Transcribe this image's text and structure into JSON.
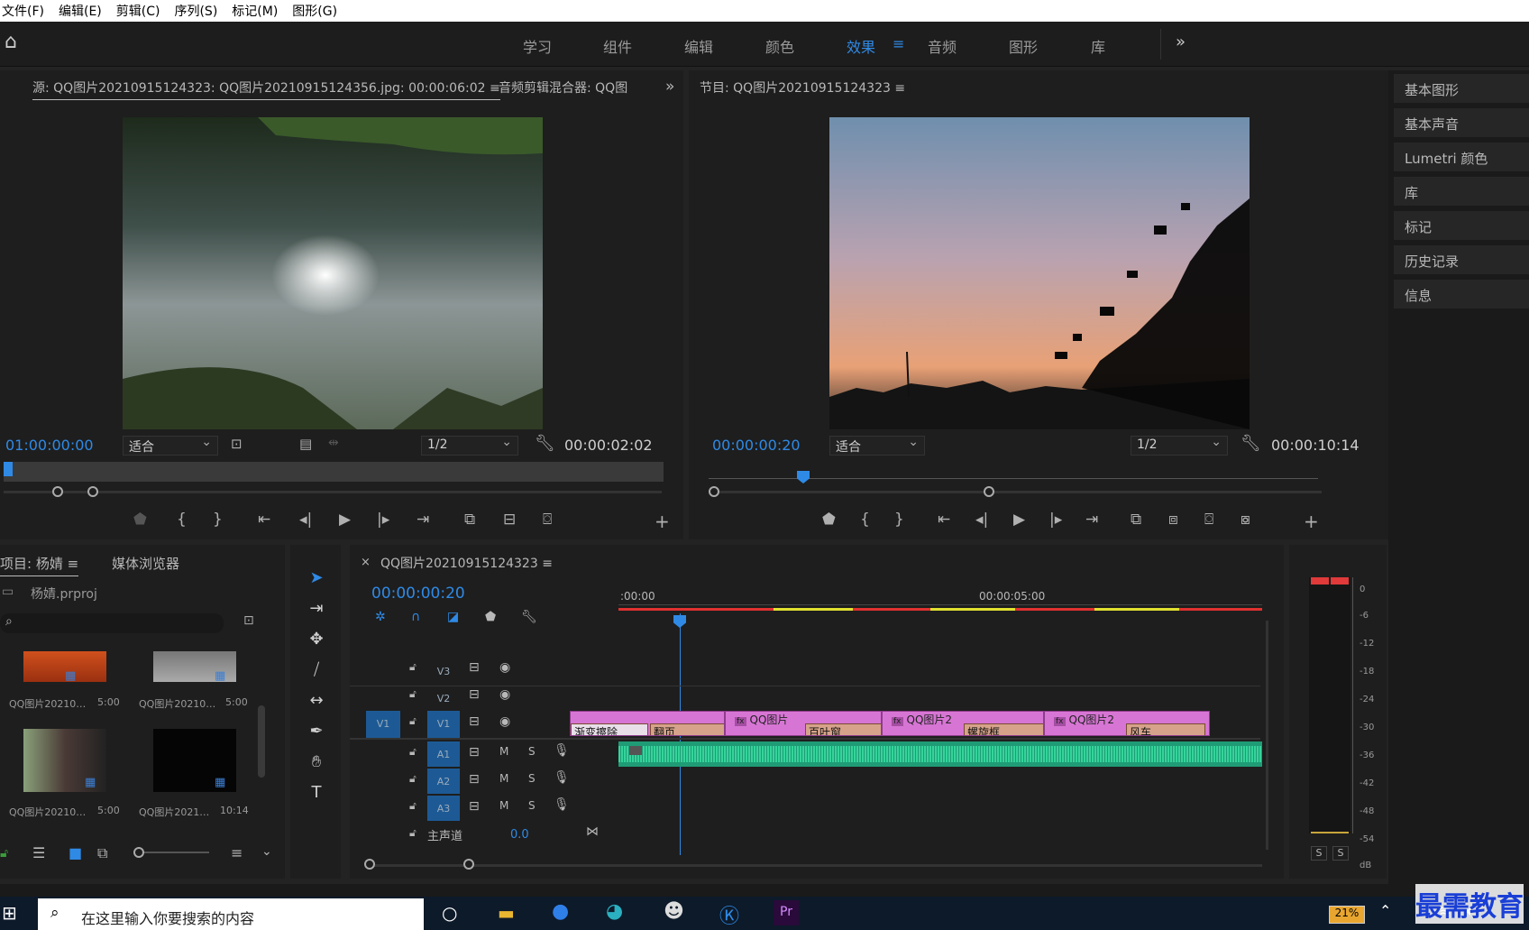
{
  "menu": {
    "file": "文件(F)",
    "edit": "编辑(E)",
    "clip": "剪辑(C)",
    "sequence": "序列(S)",
    "marker": "标记(M)",
    "graphics": "图形(G)"
  },
  "workspaces": {
    "learn": "学习",
    "assembly": "组件",
    "editing": "编辑",
    "color": "颜色",
    "effects": "效果",
    "audio": "音频",
    "graphics": "图形",
    "libraries": "库"
  },
  "source": {
    "tab": "源: QQ图片20210915124323: QQ图片20210915124356.jpg: 00:00:06:02",
    "tab2": "音频剪辑混合器: QQ图",
    "timecode": "01:00:00:00",
    "fit": "适合",
    "res": "1/2",
    "duration": "00:00:02:02"
  },
  "program": {
    "tab": "节目: QQ图片20210915124323",
    "timecode": "00:00:00:20",
    "fit": "适合",
    "res": "1/2",
    "duration": "00:00:10:14"
  },
  "sidebar": {
    "items": [
      "基本图形",
      "基本声音",
      "Lumetri 颜色",
      "库",
      "标记",
      "历史记录",
      "信息"
    ]
  },
  "project": {
    "tab": "项目: 杨婧",
    "tab2": "媒体浏览器",
    "file": "杨婧.prproj",
    "items": [
      {
        "name": "QQ图片20210…",
        "dur": "5:00"
      },
      {
        "name": "QQ图片20210…",
        "dur": "5:00"
      },
      {
        "name": "QQ图片20210…",
        "dur": "5:00"
      },
      {
        "name": "QQ图片2021…",
        "dur": "10:14"
      }
    ]
  },
  "timeline": {
    "tab": "QQ图片20210915124323",
    "timecode": "00:00:00:20",
    "ruler_start": ":00:00",
    "ruler_mid": "00:00:05:00",
    "tracks": {
      "v3": "V3",
      "v2": "V2",
      "v1": "V1",
      "v1src": "V1",
      "a1": "A1",
      "a2": "A2",
      "a3": "A3",
      "m": "M",
      "s": "S",
      "master": "主声道",
      "master_val": "0.0"
    },
    "clips": [
      {
        "name": "QQ图片"
      },
      {
        "name": "QQ图片2"
      },
      {
        "name": "QQ图片2"
      }
    ],
    "transitions": [
      "渐变擦除",
      "翻页",
      "百叶窗",
      "螺旋框",
      "风车"
    ]
  },
  "meter": {
    "labels": [
      "0",
      "-6",
      "-12",
      "-18",
      "-24",
      "-30",
      "-36",
      "-42",
      "-48",
      "-54",
      "dB"
    ],
    "s1": "S",
    "s2": "S"
  },
  "taskbar": {
    "search_placeholder": "在这里输入你要搜索的内容",
    "battery": "21%",
    "watermark": "最需教育"
  }
}
